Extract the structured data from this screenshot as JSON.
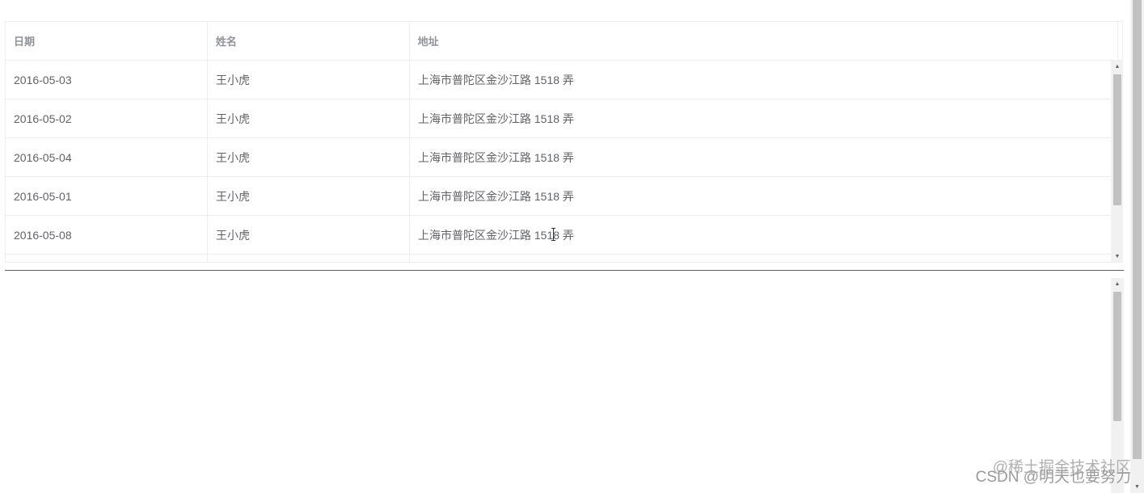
{
  "table": {
    "columns": [
      "日期",
      "姓名",
      "地址"
    ],
    "rows": [
      {
        "date": "2016-05-03",
        "name": "王小虎",
        "address": "上海市普陀区金沙江路 1518 弄"
      },
      {
        "date": "2016-05-02",
        "name": "王小虎",
        "address": "上海市普陀区金沙江路 1518 弄"
      },
      {
        "date": "2016-05-04",
        "name": "王小虎",
        "address": "上海市普陀区金沙江路 1518 弄"
      },
      {
        "date": "2016-05-01",
        "name": "王小虎",
        "address": "上海市普陀区金沙江路 1518 弄"
      },
      {
        "date": "2016-05-08",
        "name": "王小虎",
        "address": "上海市普陀区金沙江路 1518 弄"
      }
    ]
  },
  "watermark": {
    "line1": "@稀土掘金技术社区",
    "line2": "CSDN @明天也要努力"
  },
  "icons": {
    "scroll_up": "scroll-up-arrow-icon",
    "scroll_down": "scroll-down-arrow-icon",
    "text_cursor": "text-cursor-icon"
  },
  "colors": {
    "border": "#ebeef5",
    "header_text": "#909399",
    "body_text": "#606266",
    "scrollbar_track": "#f1f1f1",
    "scrollbar_thumb": "#c1c1c1"
  }
}
